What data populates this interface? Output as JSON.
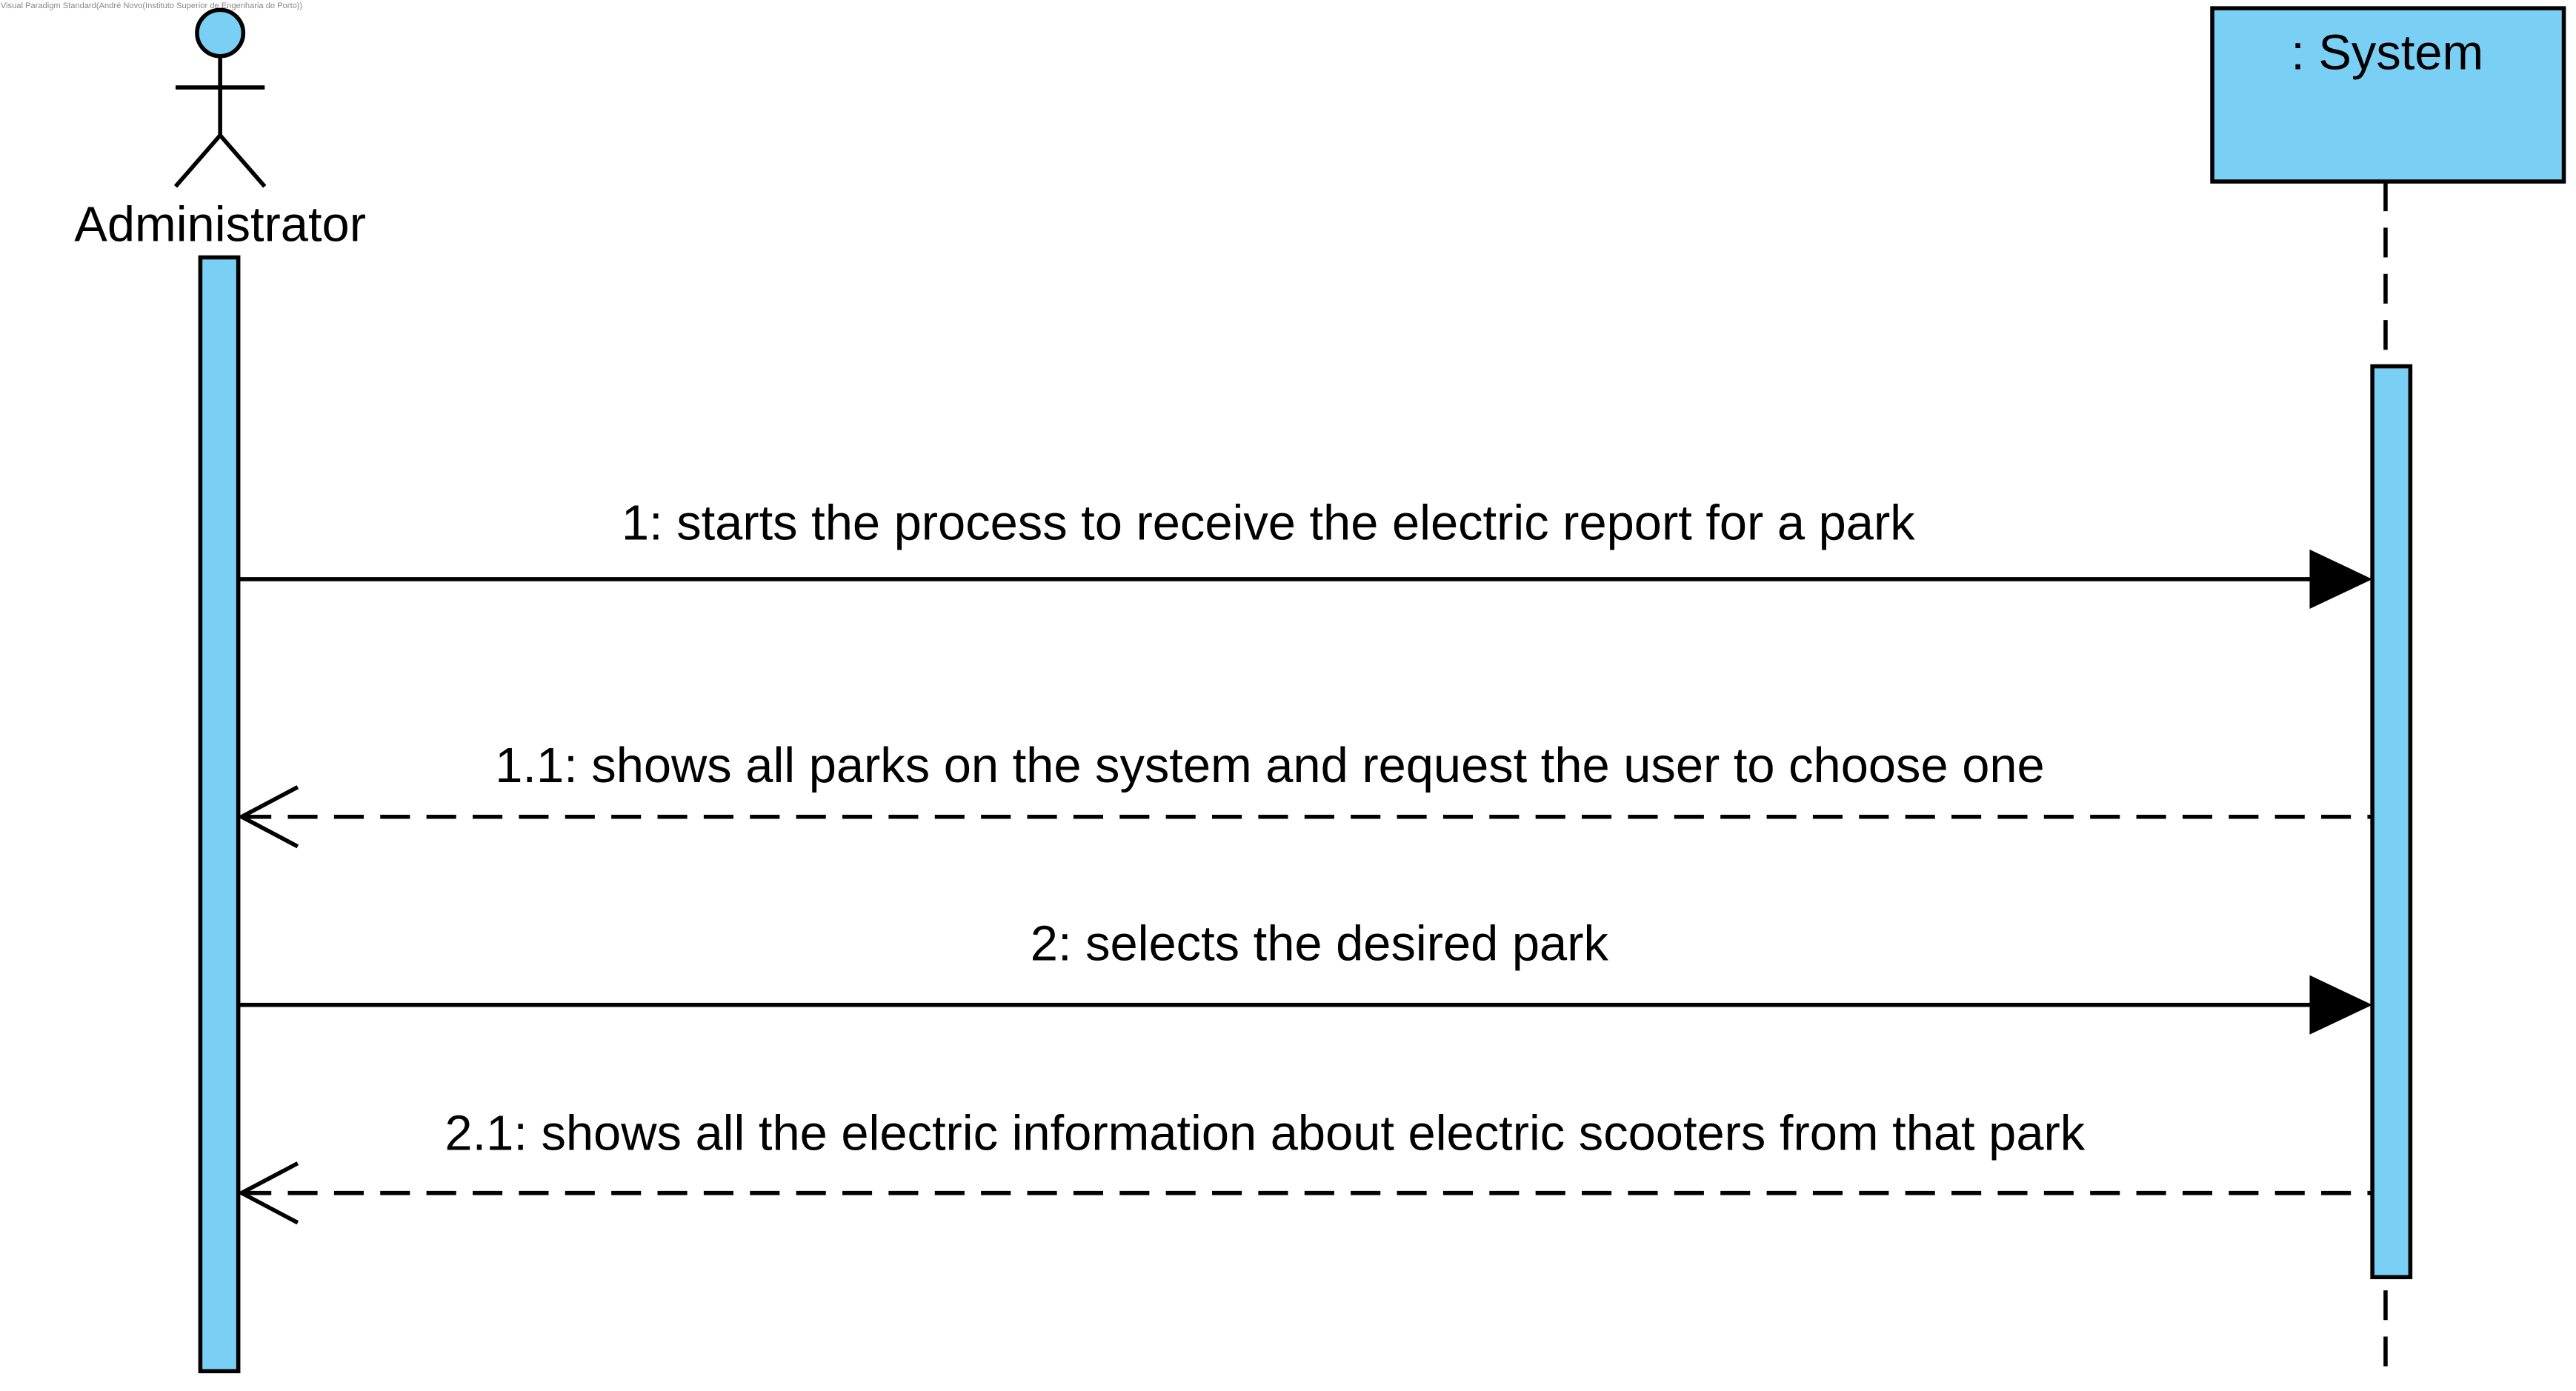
{
  "watermark": "Visual Paradigm Standard(André Novo(Instituto Superior de Engenharia do Porto))",
  "colors": {
    "fill": "#7ACFF5",
    "stroke": "#000000"
  },
  "participants": {
    "actor": {
      "name": "Administrator",
      "icon": "stick-figure-icon"
    },
    "system": {
      "name": ": System"
    }
  },
  "messages": [
    {
      "label": "1: starts the process to receive the electric report for a park",
      "type": "synchronous",
      "from": "Administrator",
      "to": ": System"
    },
    {
      "label": "1.1: shows all parks on the system and request the user to choose one",
      "type": "return",
      "from": ": System",
      "to": "Administrator"
    },
    {
      "label": "2: selects the desired park",
      "type": "synchronous",
      "from": "Administrator",
      "to": ": System"
    },
    {
      "label": "2.1: shows all the electric information about electric scooters from that park",
      "type": "return",
      "from": ": System",
      "to": "Administrator"
    }
  ]
}
